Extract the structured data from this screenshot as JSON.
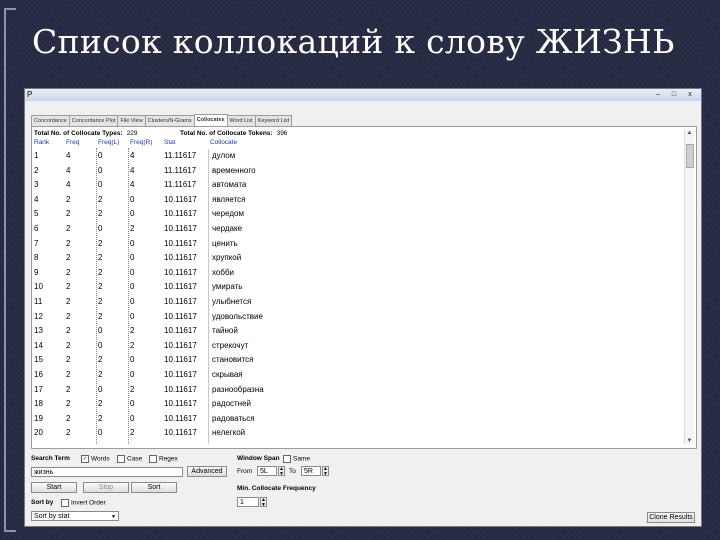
{
  "slide": {
    "title": "Список коллокаций к слову ЖИЗНЬ"
  },
  "window": {
    "icon_glyph": "P",
    "controls": [
      "–",
      "□",
      "x"
    ]
  },
  "tabs": [
    {
      "label": "Concordance",
      "active": false
    },
    {
      "label": "Concordance Plot",
      "active": false
    },
    {
      "label": "File View",
      "active": false
    },
    {
      "label": "Clusters/N-Grams",
      "active": false
    },
    {
      "label": "Collocates",
      "active": true
    },
    {
      "label": "Word List",
      "active": false
    },
    {
      "label": "Keyword List",
      "active": false
    }
  ],
  "totals": {
    "types_label": "Total No. of Collocate Types:",
    "types_value": "229",
    "tokens_label": "Total No. of Collocate Tokens:",
    "tokens_value": "396"
  },
  "columns": [
    "Rank",
    "Freq",
    "Freq(L)",
    "Freq(R)",
    "Stat",
    "Collocate"
  ],
  "rows": [
    {
      "rank": "1",
      "freq": "4",
      "freq_l": "0",
      "freq_r": "4",
      "stat": "11.11617",
      "collocate": "дулом"
    },
    {
      "rank": "2",
      "freq": "4",
      "freq_l": "0",
      "freq_r": "4",
      "stat": "11.11617",
      "collocate": "временного"
    },
    {
      "rank": "3",
      "freq": "4",
      "freq_l": "0",
      "freq_r": "4",
      "stat": "11.11617",
      "collocate": "автомата"
    },
    {
      "rank": "4",
      "freq": "2",
      "freq_l": "2",
      "freq_r": "0",
      "stat": "10.11617",
      "collocate": "является"
    },
    {
      "rank": "5",
      "freq": "2",
      "freq_l": "2",
      "freq_r": "0",
      "stat": "10.11617",
      "collocate": "чередом"
    },
    {
      "rank": "6",
      "freq": "2",
      "freq_l": "0",
      "freq_r": "2",
      "stat": "10.11617",
      "collocate": "чердаке"
    },
    {
      "rank": "7",
      "freq": "2",
      "freq_l": "2",
      "freq_r": "0",
      "stat": "10.11617",
      "collocate": "ценить"
    },
    {
      "rank": "8",
      "freq": "2",
      "freq_l": "2",
      "freq_r": "0",
      "stat": "10.11617",
      "collocate": "хрупкой"
    },
    {
      "rank": "9",
      "freq": "2",
      "freq_l": "2",
      "freq_r": "0",
      "stat": "10.11617",
      "collocate": "хобби"
    },
    {
      "rank": "10",
      "freq": "2",
      "freq_l": "2",
      "freq_r": "0",
      "stat": "10.11617",
      "collocate": "умирать"
    },
    {
      "rank": "11",
      "freq": "2",
      "freq_l": "2",
      "freq_r": "0",
      "stat": "10.11617",
      "collocate": "улыбнется"
    },
    {
      "rank": "12",
      "freq": "2",
      "freq_l": "2",
      "freq_r": "0",
      "stat": "10.11617",
      "collocate": "удовольствие"
    },
    {
      "rank": "13",
      "freq": "2",
      "freq_l": "0",
      "freq_r": "2",
      "stat": "10.11617",
      "collocate": "тайной"
    },
    {
      "rank": "14",
      "freq": "2",
      "freq_l": "0",
      "freq_r": "2",
      "stat": "10.11617",
      "collocate": "стрекочут"
    },
    {
      "rank": "15",
      "freq": "2",
      "freq_l": "2",
      "freq_r": "0",
      "stat": "10.11617",
      "collocate": "становится"
    },
    {
      "rank": "16",
      "freq": "2",
      "freq_l": "2",
      "freq_r": "0",
      "stat": "10.11617",
      "collocate": "скрывая"
    },
    {
      "rank": "17",
      "freq": "2",
      "freq_l": "0",
      "freq_r": "2",
      "stat": "10.11617",
      "collocate": "разнообразна"
    },
    {
      "rank": "18",
      "freq": "2",
      "freq_l": "2",
      "freq_r": "0",
      "stat": "10.11617",
      "collocate": "радостней"
    },
    {
      "rank": "19",
      "freq": "2",
      "freq_l": "2",
      "freq_r": "0",
      "stat": "10.11617",
      "collocate": "радоваться"
    },
    {
      "rank": "20",
      "freq": "2",
      "freq_l": "0",
      "freq_r": "2",
      "stat": "10.11617",
      "collocate": "нелегкой"
    }
  ],
  "controls": {
    "search_term_label": "Search Term",
    "words_label": "Words",
    "case_label": "Case",
    "regex_label": "Regex",
    "search_value": "жизнь",
    "advanced_label": "Advanced",
    "start_label": "Start",
    "stop_label": "Stop",
    "sort_button_label": "Sort",
    "sort_by_label": "Sort by",
    "invert_order_label": "Invert Order",
    "sort_by_value": "Sort by stat",
    "window_span_label": "Window Span",
    "same_label": "Same",
    "from_label": "From",
    "from_value": "5L",
    "to_label": "To",
    "to_value": "5R",
    "min_freq_label": "Min. Collocate Frequency",
    "min_freq_value": "1",
    "clone_label": "Clone Results"
  }
}
